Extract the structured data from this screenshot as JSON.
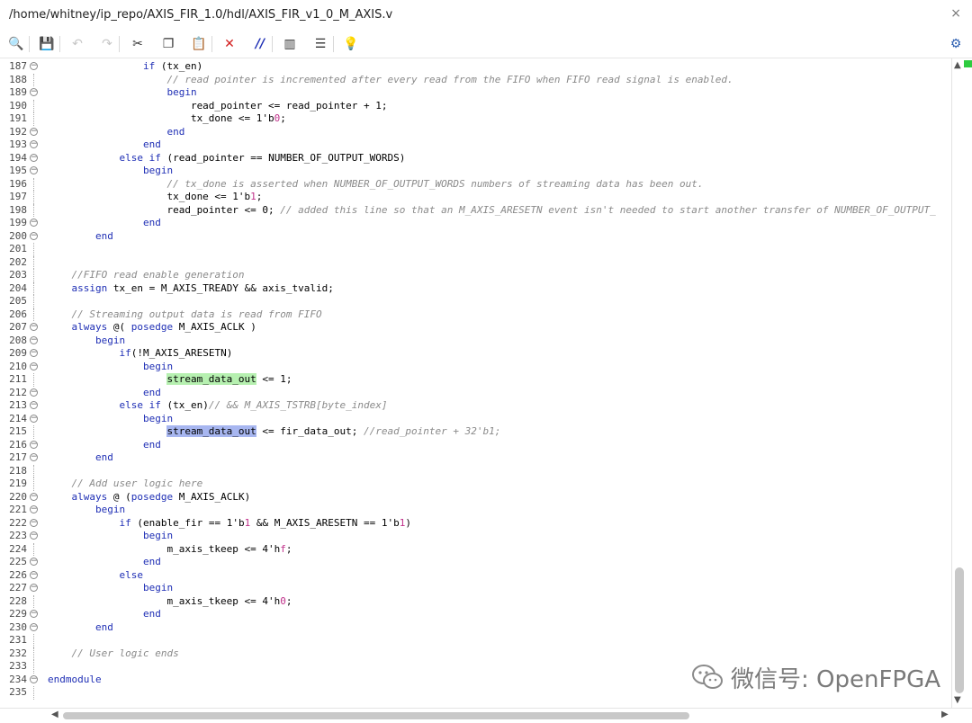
{
  "window": {
    "title": "/home/whitney/ip_repo/AXIS_FIR_1.0/hdl/AXIS_FIR_v1_0_M_AXIS.v",
    "close_glyph": "×"
  },
  "toolbar": {
    "buttons": [
      {
        "name": "search",
        "glyph": "🔍",
        "enabled": true
      },
      {
        "name": "save",
        "glyph": "💾",
        "enabled": false
      },
      {
        "name": "undo",
        "glyph": "↶",
        "enabled": false
      },
      {
        "name": "redo",
        "glyph": "↷",
        "enabled": false
      },
      {
        "name": "cut",
        "glyph": "✂",
        "enabled": true
      },
      {
        "name": "copy",
        "glyph": "❐",
        "enabled": true
      },
      {
        "name": "paste",
        "glyph": "📋",
        "enabled": true
      },
      {
        "name": "delete",
        "glyph": "✕",
        "enabled": true
      },
      {
        "name": "comment",
        "glyph": "//",
        "enabled": true
      },
      {
        "name": "column-select",
        "glyph": "▥",
        "enabled": true
      },
      {
        "name": "indent",
        "glyph": "☰",
        "enabled": true
      },
      {
        "name": "hint",
        "glyph": "💡",
        "enabled": true
      }
    ],
    "settings_glyph": "⚙"
  },
  "editor": {
    "lines": [
      {
        "n": "187",
        "fold": "open",
        "code": "                if (tx_en)"
      },
      {
        "n": "188",
        "fold": "none",
        "code": "                    // read pointer is incremented after every read from the FIFO when FIFO read signal is enabled."
      },
      {
        "n": "189",
        "fold": "open",
        "code": "                    begin"
      },
      {
        "n": "190",
        "fold": "none",
        "code": "                        read_pointer <= read_pointer + 1;"
      },
      {
        "n": "191",
        "fold": "none",
        "code": "                        tx_done <= 1'b0;"
      },
      {
        "n": "192",
        "fold": "close",
        "code": "                    end"
      },
      {
        "n": "193",
        "fold": "close",
        "code": "                end"
      },
      {
        "n": "194",
        "fold": "open",
        "code": "            else if (read_pointer == NUMBER_OF_OUTPUT_WORDS)"
      },
      {
        "n": "195",
        "fold": "open",
        "code": "                begin"
      },
      {
        "n": "196",
        "fold": "none",
        "code": "                    // tx_done is asserted when NUMBER_OF_OUTPUT_WORDS numbers of streaming data has been out."
      },
      {
        "n": "197",
        "fold": "none",
        "code": "                    tx_done <= 1'b1;"
      },
      {
        "n": "198",
        "fold": "none",
        "code": "                    read_pointer <= 0; // added this line so that an M_AXIS_ARESETN event isn't needed to start another transfer of NUMBER_OF_OUTPUT_"
      },
      {
        "n": "199",
        "fold": "close",
        "code": "                end"
      },
      {
        "n": "200",
        "fold": "close",
        "code": "        end"
      },
      {
        "n": "201",
        "fold": "none",
        "code": ""
      },
      {
        "n": "202",
        "fold": "none",
        "code": ""
      },
      {
        "n": "203",
        "fold": "none",
        "code": "    //FIFO read enable generation"
      },
      {
        "n": "204",
        "fold": "none",
        "code": "    assign tx_en = M_AXIS_TREADY && axis_tvalid;"
      },
      {
        "n": "205",
        "fold": "none",
        "code": ""
      },
      {
        "n": "206",
        "fold": "none",
        "code": "    // Streaming output data is read from FIFO"
      },
      {
        "n": "207",
        "fold": "open",
        "code": "    always @( posedge M_AXIS_ACLK )"
      },
      {
        "n": "208",
        "fold": "open",
        "code": "        begin"
      },
      {
        "n": "209",
        "fold": "open",
        "code": "            if(!M_AXIS_ARESETN)"
      },
      {
        "n": "210",
        "fold": "open",
        "code": "                begin"
      },
      {
        "n": "211",
        "fold": "none",
        "code": "                    stream_data_out <= 1;"
      },
      {
        "n": "212",
        "fold": "close",
        "code": "                end"
      },
      {
        "n": "213",
        "fold": "open",
        "code": "            else if (tx_en)// && M_AXIS_TSTRB[byte_index]"
      },
      {
        "n": "214",
        "fold": "open",
        "code": "                begin"
      },
      {
        "n": "215",
        "fold": "none",
        "code": "                    stream_data_out <= fir_data_out; //read_pointer + 32'b1;"
      },
      {
        "n": "216",
        "fold": "close",
        "code": "                end"
      },
      {
        "n": "217",
        "fold": "close",
        "code": "        end"
      },
      {
        "n": "218",
        "fold": "none",
        "code": ""
      },
      {
        "n": "219",
        "fold": "none",
        "code": "    // Add user logic here"
      },
      {
        "n": "220",
        "fold": "open",
        "code": "    always @ (posedge M_AXIS_ACLK)"
      },
      {
        "n": "221",
        "fold": "open",
        "code": "        begin"
      },
      {
        "n": "222",
        "fold": "open",
        "code": "            if (enable_fir == 1'b1 && M_AXIS_ARESETN == 1'b1)"
      },
      {
        "n": "223",
        "fold": "open",
        "code": "                begin"
      },
      {
        "n": "224",
        "fold": "none",
        "code": "                    m_axis_tkeep <= 4'hf;"
      },
      {
        "n": "225",
        "fold": "close",
        "code": "                end"
      },
      {
        "n": "226",
        "fold": "open",
        "code": "            else"
      },
      {
        "n": "227",
        "fold": "open",
        "code": "                begin"
      },
      {
        "n": "228",
        "fold": "none",
        "code": "                    m_axis_tkeep <= 4'h0;"
      },
      {
        "n": "229",
        "fold": "close",
        "code": "                end"
      },
      {
        "n": "230",
        "fold": "close",
        "code": "        end"
      },
      {
        "n": "231",
        "fold": "none",
        "code": ""
      },
      {
        "n": "232",
        "fold": "none",
        "code": "    // User logic ends"
      },
      {
        "n": "233",
        "fold": "none",
        "code": ""
      },
      {
        "n": "234",
        "fold": "close",
        "code": "endmodule"
      },
      {
        "n": "235",
        "fold": "none",
        "code": ""
      }
    ],
    "highlights": [
      {
        "line": "211",
        "text": "stream_data_out",
        "color": "#b6f0b0"
      },
      {
        "line": "215",
        "text": "stream_data_out",
        "color": "#a7b6f0"
      }
    ]
  },
  "colors": {
    "keyword": "#1f2fb5",
    "comment": "#8a8a8a",
    "number": "#c0308a",
    "text": "#000000"
  },
  "watermark": {
    "text": "微信号: OpenFPGA"
  }
}
